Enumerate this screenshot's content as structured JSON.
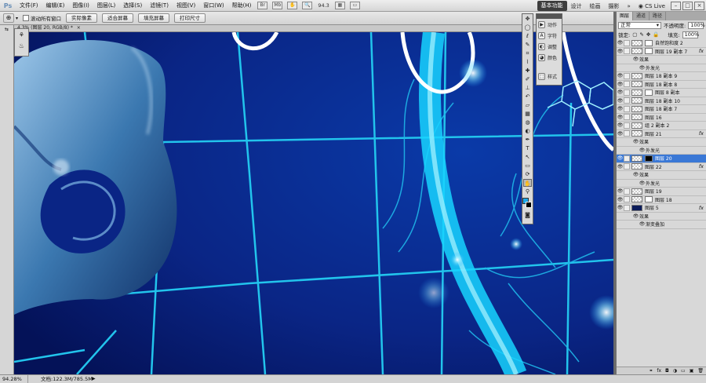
{
  "app": {
    "logo": "Ps"
  },
  "menu": [
    "文件(F)",
    "编辑(E)",
    "图像(I)",
    "图层(L)",
    "选择(S)",
    "滤镜(T)",
    "视图(V)",
    "窗口(W)",
    "帮助(H)"
  ],
  "menubar": {
    "zoom_readout": "94.3"
  },
  "workspaces": [
    "基本功能",
    "设计",
    "绘画",
    "摄影"
  ],
  "cs_live": "CS Live",
  "window_buttons": [
    "–",
    "□",
    "×"
  ],
  "options": {
    "checkbox_label": "滚动所有窗口",
    "buttons": [
      "实际像素",
      "适合屏幕",
      "填充屏幕",
      "打印尺寸"
    ]
  },
  "document_tab": {
    "title": "4.3% (图层 20, RGB/8) *"
  },
  "statusbar": {
    "zoom": "94.28%",
    "doc": "文档:122.3M/785.5M"
  },
  "action_panel": {
    "items": [
      "动作",
      "字符",
      "调整",
      "颜色",
      "样式"
    ]
  },
  "layers_panel": {
    "tabs": [
      "图层",
      "通道",
      "路径"
    ],
    "blend_mode": "正常",
    "opacity_label": "不透明度:",
    "opacity": "100%",
    "lock_label": "锁定:",
    "fill_label": "填充:",
    "fill": "100%",
    "rows": [
      {
        "name": "自然饱和度 2",
        "kind": "adjust"
      },
      {
        "name": "图层 19 副本 7",
        "kind": "masked",
        "fx": "fx"
      },
      {
        "name": "效果",
        "kind": "effects"
      },
      {
        "name": "外发光",
        "kind": "effect"
      },
      {
        "name": "图层 18 副本 9",
        "kind": "layer"
      },
      {
        "name": "图层 18 副本 8",
        "kind": "layer"
      },
      {
        "name": "图层 8 副本",
        "kind": "masked"
      },
      {
        "name": "图层 18 副本 10",
        "kind": "layer"
      },
      {
        "name": "图层 18 副本 7",
        "kind": "layer"
      },
      {
        "name": "图层 16",
        "kind": "layer"
      },
      {
        "name": "组 2 副本 2",
        "kind": "layer"
      },
      {
        "name": "图层 21",
        "kind": "layer",
        "fx": "fx"
      },
      {
        "name": "效果",
        "kind": "effects"
      },
      {
        "name": "外发光",
        "kind": "effect"
      },
      {
        "name": "图层 20",
        "kind": "selected"
      },
      {
        "name": "图层 22",
        "kind": "layer",
        "fx": "fx"
      },
      {
        "name": "效果",
        "kind": "effects"
      },
      {
        "name": "外发光",
        "kind": "effect"
      },
      {
        "name": "图层 19",
        "kind": "layer"
      },
      {
        "name": "图层 18",
        "kind": "masked"
      },
      {
        "name": "图层 5",
        "kind": "dark",
        "fx": "fx"
      },
      {
        "name": "效果",
        "kind": "effects"
      },
      {
        "name": "渐变叠加",
        "kind": "effect"
      }
    ]
  },
  "colors": {
    "canvas_bg": "#061a6a",
    "grid": "#20c8f0",
    "selection": "#3a78d6"
  }
}
